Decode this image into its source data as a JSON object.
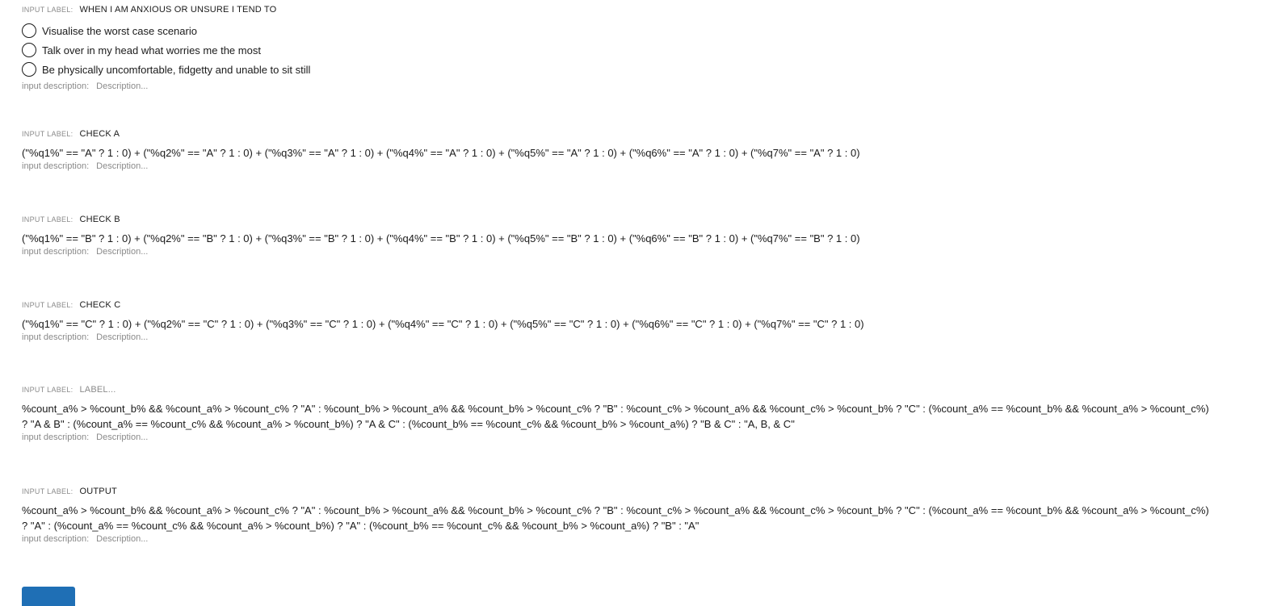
{
  "label_tag": "INPUT LABEL:",
  "desc_tag": "input description:",
  "desc_placeholder": "Description...",
  "question": {
    "label": "WHEN I AM ANXIOUS OR UNSURE I TEND TO",
    "options": [
      "Visualise the worst case scenario",
      "Talk over in my head what worries me the most",
      "Be physically uncomfortable, fidgetty and unable to sit still"
    ]
  },
  "check_a": {
    "label": "CHECK A",
    "formula": "(\"%q1%\" == \"A\" ? 1 : 0) + (\"%q2%\" == \"A\" ? 1 : 0) + (\"%q3%\" == \"A\" ? 1 : 0) + (\"%q4%\" == \"A\" ? 1 : 0) + (\"%q5%\" == \"A\" ? 1 : 0) + (\"%q6%\" == \"A\" ? 1 : 0) + (\"%q7%\" == \"A\" ? 1 : 0)"
  },
  "check_b": {
    "label": "CHECK B",
    "formula": "(\"%q1%\" == \"B\" ? 1 : 0) + (\"%q2%\" == \"B\" ? 1 : 0) + (\"%q3%\" == \"B\" ? 1 : 0) + (\"%q4%\" == \"B\" ? 1 : 0) + (\"%q5%\" == \"B\" ? 1 : 0) + (\"%q6%\" == \"B\" ? 1 : 0) + (\"%q7%\" == \"B\" ? 1 : 0)"
  },
  "check_c": {
    "label": "CHECK C",
    "formula": "(\"%q1%\" == \"C\" ? 1 : 0) + (\"%q2%\" == \"C\" ? 1 : 0) + (\"%q3%\" == \"C\" ? 1 : 0) + (\"%q4%\" == \"C\" ? 1 : 0) + (\"%q5%\" == \"C\" ? 1 : 0) + (\"%q6%\" == \"C\" ? 1 : 0) + (\"%q7%\" == \"C\" ? 1 : 0)"
  },
  "unlabeled": {
    "label_placeholder": "LABEL...",
    "formula": "%count_a% > %count_b% && %count_a% > %count_c% ? \"A\" : %count_b% > %count_a% && %count_b% > %count_c% ? \"B\" : %count_c% > %count_a% && %count_c% > %count_b% ? \"C\" : (%count_a% == %count_b% && %count_a% > %count_c%) ? \"A & B\" : (%count_a% == %count_c% && %count_a% > %count_b%) ? \"A & C\" : (%count_b% == %count_c% && %count_b% > %count_a%) ? \"B & C\" : \"A, B, & C\""
  },
  "output": {
    "label": "OUTPUT",
    "formula": "%count_a% > %count_b% && %count_a% > %count_c% ? \"A\" : %count_b% > %count_a% && %count_b% > %count_c% ? \"B\" : %count_c% > %count_a% && %count_c% > %count_b% ? \"C\" : (%count_a% == %count_b% && %count_a% > %count_c%) ? \"A\" : (%count_a% == %count_c% && %count_a% > %count_b%) ? \"A\" : (%count_b% == %count_c% && %count_b% > %count_a%) ? \"B\" : \"A\""
  },
  "colors": {
    "accent": "#1f6fb5",
    "muted": "#8a8a8a",
    "text": "#1a1a1a"
  }
}
